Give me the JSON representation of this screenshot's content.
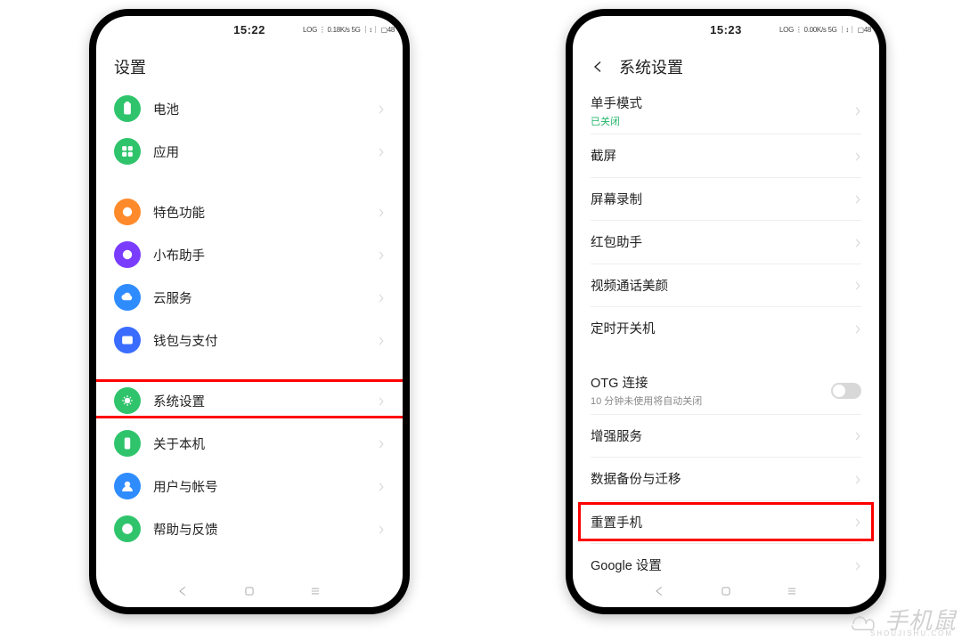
{
  "phoneA": {
    "status": {
      "time": "15:22",
      "indicators_left": "",
      "indicators_right": "LOG ⋮ 0.18K/s 5G ｜↕｜ ▢48"
    },
    "header": {
      "title": "设置"
    },
    "groups": [
      [
        {
          "key": "battery",
          "label": "电池",
          "iconColor": "bg-green"
        },
        {
          "key": "apps",
          "label": "应用",
          "iconColor": "bg-green2"
        }
      ],
      [
        {
          "key": "features",
          "label": "特色功能",
          "iconColor": "bg-orange"
        },
        {
          "key": "breeno",
          "label": "小布助手",
          "iconColor": "bg-purple"
        },
        {
          "key": "cloud",
          "label": "云服务",
          "iconColor": "bg-blue"
        },
        {
          "key": "wallet",
          "label": "钱包与支付",
          "iconColor": "bg-blue2"
        }
      ],
      [
        {
          "key": "system",
          "label": "系统设置",
          "iconColor": "bg-green",
          "highlight": true
        },
        {
          "key": "about",
          "label": "关于本机",
          "iconColor": "bg-green2"
        },
        {
          "key": "account",
          "label": "用户与帐号",
          "iconColor": "bg-blue3"
        },
        {
          "key": "help",
          "label": "帮助与反馈",
          "iconColor": "bg-green"
        }
      ]
    ]
  },
  "phoneB": {
    "status": {
      "time": "15:23",
      "indicators_left": "",
      "indicators_right": "LOG ⋮ 0.00K/s 5G ｜↕｜ ▢48"
    },
    "header": {
      "title": "系统设置",
      "back": true
    },
    "groups": [
      [
        {
          "key": "onehand",
          "label": "单手模式",
          "status": "已关闭",
          "statusGreen": true
        },
        {
          "key": "screenshot",
          "label": "截屏"
        },
        {
          "key": "record",
          "label": "屏幕录制"
        },
        {
          "key": "redpacket",
          "label": "红包助手"
        },
        {
          "key": "beauty",
          "label": "视频通话美颜"
        },
        {
          "key": "schedule",
          "label": "定时开关机"
        }
      ],
      [
        {
          "key": "otg",
          "label": "OTG 连接",
          "sub": "10 分钟未使用将自动关闭",
          "toggle": true
        },
        {
          "key": "enhance",
          "label": "增强服务"
        },
        {
          "key": "backup",
          "label": "数据备份与迁移"
        },
        {
          "key": "reset",
          "label": "重置手机",
          "highlight": true
        },
        {
          "key": "google",
          "label": "Google 设置"
        }
      ]
    ]
  },
  "watermark": {
    "text": "手机鼠",
    "sub": "SHOUJISHU.COM"
  }
}
